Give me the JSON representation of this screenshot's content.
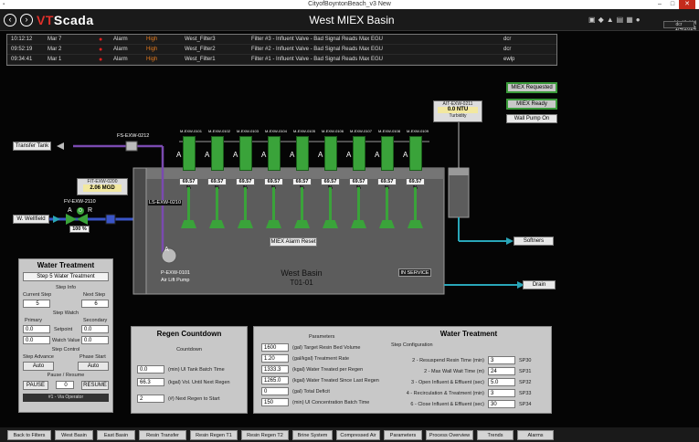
{
  "window": {
    "title": "CityofBoyntonBeach_v3 New"
  },
  "topbar": {
    "logo_prefix": "VT",
    "logo_suffix": "Scada",
    "page_title": "West MIEX Basin",
    "time": "11:48 AM",
    "date": "1/4/2024",
    "user": "dcr"
  },
  "alarms": [
    {
      "time": "10:12:12",
      "date": "Mar 7",
      "type": "Alarm",
      "priority": "High",
      "tag": "West_Filter3",
      "message": "Filter #3 - Influent Valve - Bad Signal Reads Max EGU",
      "user": "dcr"
    },
    {
      "time": "09:52:19",
      "date": "Mar 2",
      "type": "Alarm",
      "priority": "High",
      "tag": "West_Filter2",
      "message": "Filter #2 - Influent Valve - Bad Signal Reads Max EGU",
      "user": "dcr"
    },
    {
      "time": "09:34:41",
      "date": "Mar 1",
      "type": "Alarm",
      "priority": "High",
      "tag": "West_Filter1",
      "message": "Filter #1 - Influent Valve - Bad Signal Reads Max EGU",
      "user": "ewlp"
    }
  ],
  "status_buttons": {
    "miex_requested": "MIEX Requested",
    "miex_ready": "MIEX Ready",
    "wall_pump_on": "Wall Pump On"
  },
  "turbidity": {
    "tag": "AIT-EXW-0211",
    "value": "0.0 NTU",
    "label": "Turbidity"
  },
  "process": {
    "transfer_tank": "Transfer Tank",
    "fs_tag": "FS-EXW-0212",
    "fit_tag": "FIT-EXW-0200",
    "fit_value": "2.06 MGD",
    "fv_tag": "FV-EXW-2110",
    "valve_a": "A",
    "valve_o": "O",
    "valve_r": "R",
    "valve_pct": "100 %",
    "wellfield": "W. Wellfield",
    "ls_tag": "LS-EXW-0210",
    "airlift_tag": "P-EXW-0101",
    "airlift_label": "Air Lift Pump",
    "airlift_mode": "A",
    "alarm_reset": "MIEX Alarm Reset",
    "basin_name": "West Basin",
    "basin_id": "T01-01",
    "in_service": "IN SERVICE",
    "softners": "Softners",
    "drain": "Drain"
  },
  "mixers": [
    {
      "tag": "M-EXW-0101",
      "mode": "A",
      "value": "69.57 %"
    },
    {
      "tag": "M-EXW-0102",
      "mode": "A",
      "value": "69.57 %"
    },
    {
      "tag": "M-EXW-0103",
      "mode": "A",
      "value": "69.57 %"
    },
    {
      "tag": "M-EXW-0104",
      "mode": "A",
      "value": "69.57 %"
    },
    {
      "tag": "M-EXW-0105",
      "mode": "A",
      "value": "69.57 %"
    },
    {
      "tag": "M-EXW-0106",
      "mode": "A",
      "value": "69.57 %"
    },
    {
      "tag": "M-EXW-0107",
      "mode": "A",
      "value": "69.57 %"
    },
    {
      "tag": "M-EXW-0108",
      "mode": "A",
      "value": "69.57 %"
    },
    {
      "tag": "M-EXW-0109",
      "mode": "A",
      "value": "69.57 %"
    }
  ],
  "water_treatment_left": {
    "title": "Water Treatment",
    "step_button": "Step 5 Water Treatment",
    "step_info": "Step Info",
    "current_step_label": "Current Step",
    "current_step": "5",
    "next_step_label": "Next Step",
    "next_step": "6",
    "step_watch": "Step Watch",
    "primary_label": "Primary",
    "secondary_label": "Secondary",
    "setpoint_label": "Setpoint",
    "setpoint_primary": "0.0",
    "setpoint_secondary": "0.0",
    "watch_label": "Watch Value",
    "watch_primary": "0.0",
    "watch_secondary": "0.0",
    "step_control": "Step Control",
    "step_advance_label": "Step Advance",
    "step_advance": "Auto",
    "phase_start_label": "Phase Start",
    "phase_start": "Auto",
    "pause_resume": "Pause / Resume",
    "pause": "PAUSE",
    "pause_value": "0",
    "resume": "RESUME",
    "operator": "#1 - Via Operator"
  },
  "regen": {
    "title": "Regen Countdown",
    "countdown": "Countdown",
    "rows": [
      {
        "value": "0.0",
        "label": "(min) UI Tank Batch Time"
      },
      {
        "value": "66.3",
        "label": "(kgal) Vol. Until Next Regen"
      },
      {
        "value": "2",
        "label": "(#) Next Regen to Start"
      }
    ]
  },
  "water_treatment_right": {
    "title": "Water Treatment",
    "parameters_label": "Parameters",
    "config_label": "Step Configuration",
    "parameters": [
      {
        "value": "1600",
        "label": "(gal) Target Resin Bed Volume"
      },
      {
        "value": "1.20",
        "label": "(gal/kgal) Treatment Rate"
      },
      {
        "value": "1333.3",
        "label": "(kgal) Water Treated per Regen"
      },
      {
        "value": "1265.0",
        "label": "(kgal) Water Treated Since Last Regen"
      },
      {
        "value": "0",
        "label": "(gal) Total Deficit"
      },
      {
        "value": "150",
        "label": "(min) UI Concentration Batch Time"
      }
    ],
    "config": [
      {
        "label": "2 - Resuspend Resin Time (min)",
        "value": "3",
        "sp": "SP30"
      },
      {
        "label": "2 - Max Wall Wait Time (m)",
        "value": "24",
        "sp": "SP31"
      },
      {
        "label": "3 - Open Influent & Effluent (sec)",
        "value": "5.0",
        "sp": "SP32"
      },
      {
        "label": "4 - Recirculation & Treatment (min)",
        "value": "3",
        "sp": "SP33"
      },
      {
        "label": "6 - Close Influent & Effluent (sec)",
        "value": "30",
        "sp": "SP34"
      }
    ]
  },
  "nav": [
    "Back to Filters",
    "West Basin",
    "East Basin",
    "Resin Transfer",
    "Resin Regen T1",
    "Resin Regen T2",
    "Brine System",
    "Compressed Air",
    "Parameters",
    "Process Overview",
    "Trends",
    "Alarms"
  ],
  "colors": {
    "pipe_blue": "#3a55c8",
    "pipe_cyan": "#29a6b8",
    "mixer_green": "#3aa33a",
    "alarm_red": "#e02020",
    "priority_orange": "#e07a20"
  }
}
